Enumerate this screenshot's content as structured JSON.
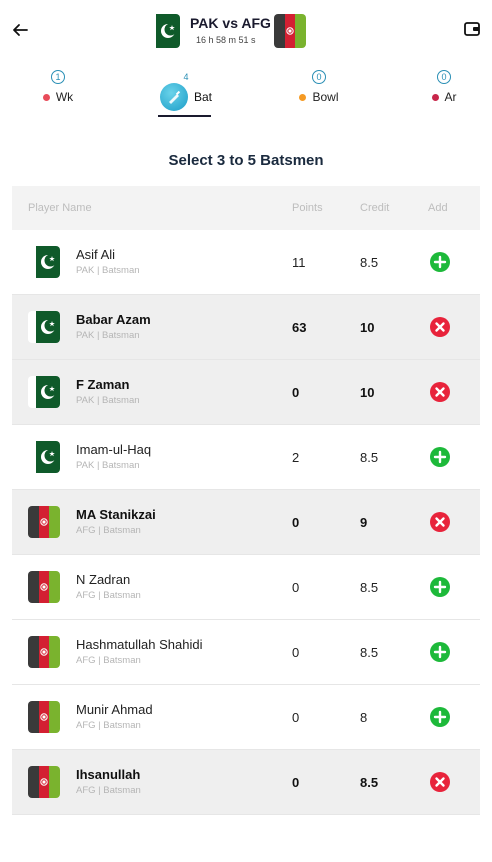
{
  "header": {
    "back_icon": "arrow-left-icon",
    "match_title": "PAK vs AFG",
    "timer": "16 h 58 m 51 s",
    "wallet_icon": "wallet-icon",
    "team1_flag": "pakistan-flag",
    "team2_flag": "afghanistan-flag"
  },
  "tabs": [
    {
      "label": "Wk",
      "count": "1",
      "dot_color": "#e84c5a"
    },
    {
      "label": "Bat",
      "count": "4",
      "icon": "bat-icon"
    },
    {
      "label": "Bowl",
      "count": "0",
      "dot_color": "#f59a23"
    },
    {
      "label": "Ar",
      "count": "0",
      "dot_color": "#c8264a"
    }
  ],
  "heading": "Select 3 to 5 Batsmen",
  "table": {
    "columns": [
      "Player Name",
      "Points",
      "Credit",
      "Add"
    ],
    "rows": [
      {
        "name": "Asif Ali",
        "sub": "PAK | Batsman",
        "points": "11",
        "credit": "8.5",
        "selected": false,
        "team": "PAK"
      },
      {
        "name": "Babar Azam",
        "sub": "PAK | Batsman",
        "points": "63",
        "credit": "10",
        "selected": true,
        "team": "PAK"
      },
      {
        "name": "F Zaman",
        "sub": "PAK | Batsman",
        "points": "0",
        "credit": "10",
        "selected": true,
        "team": "PAK"
      },
      {
        "name": "Imam-ul-Haq",
        "sub": "PAK | Batsman",
        "points": "2",
        "credit": "8.5",
        "selected": false,
        "team": "PAK"
      },
      {
        "name": "MA Stanikzai",
        "sub": "AFG | Batsman",
        "points": "0",
        "credit": "9",
        "selected": true,
        "team": "AFG"
      },
      {
        "name": "N Zadran",
        "sub": "AFG | Batsman",
        "points": "0",
        "credit": "8.5",
        "selected": false,
        "team": "AFG"
      },
      {
        "name": "Hashmatullah Shahidi",
        "sub": "AFG | Batsman",
        "points": "0",
        "credit": "8.5",
        "selected": false,
        "team": "AFG"
      },
      {
        "name": "Munir Ahmad",
        "sub": "AFG | Batsman",
        "points": "0",
        "credit": "8",
        "selected": false,
        "team": "AFG"
      },
      {
        "name": "Ihsanullah",
        "sub": "AFG | Batsman",
        "points": "0",
        "credit": "8.5",
        "selected": true,
        "team": "AFG"
      }
    ]
  },
  "colors": {
    "add": "#1db93a",
    "remove": "#e8233b",
    "accent": "#2a8fb5"
  }
}
